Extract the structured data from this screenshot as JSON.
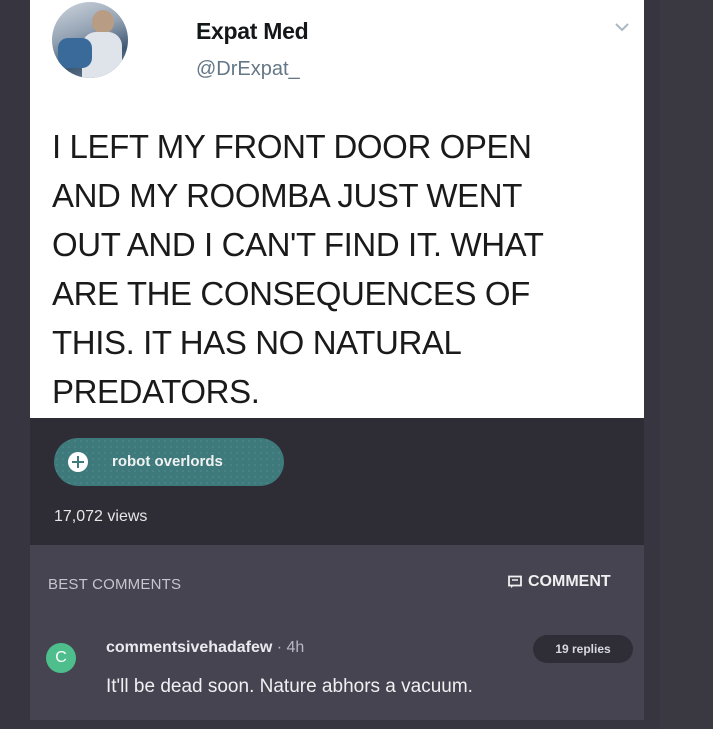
{
  "post": {
    "author_name": "Expat Med",
    "author_handle": "@DrExpat_",
    "text": "I LEFT MY FRONT DOOR OPEN\nAND MY ROOMBA JUST WENT\nOUT AND I CAN'T FIND IT. WHAT\nARE THE CONSEQUENCES OF\nTHIS. IT HAS NO NATURAL\nPREDATORS."
  },
  "meta": {
    "tag_label": "robot overlords",
    "views": "17,072 views"
  },
  "comments": {
    "header": "BEST COMMENTS",
    "comment_button": "COMMENT",
    "items": [
      {
        "avatar_letter": "C",
        "username": "commentsivehadafew",
        "time": " · 4h",
        "replies": "19 replies",
        "body": "It'll be dead soon. Nature abhors a vacuum."
      }
    ]
  },
  "colors": {
    "page_background": "#37353f",
    "tag_background": "#3e7a7c",
    "comment_avatar": "#4dbe8c"
  },
  "icons": [
    "plus-icon",
    "chevron-down-icon",
    "comment-icon"
  ]
}
